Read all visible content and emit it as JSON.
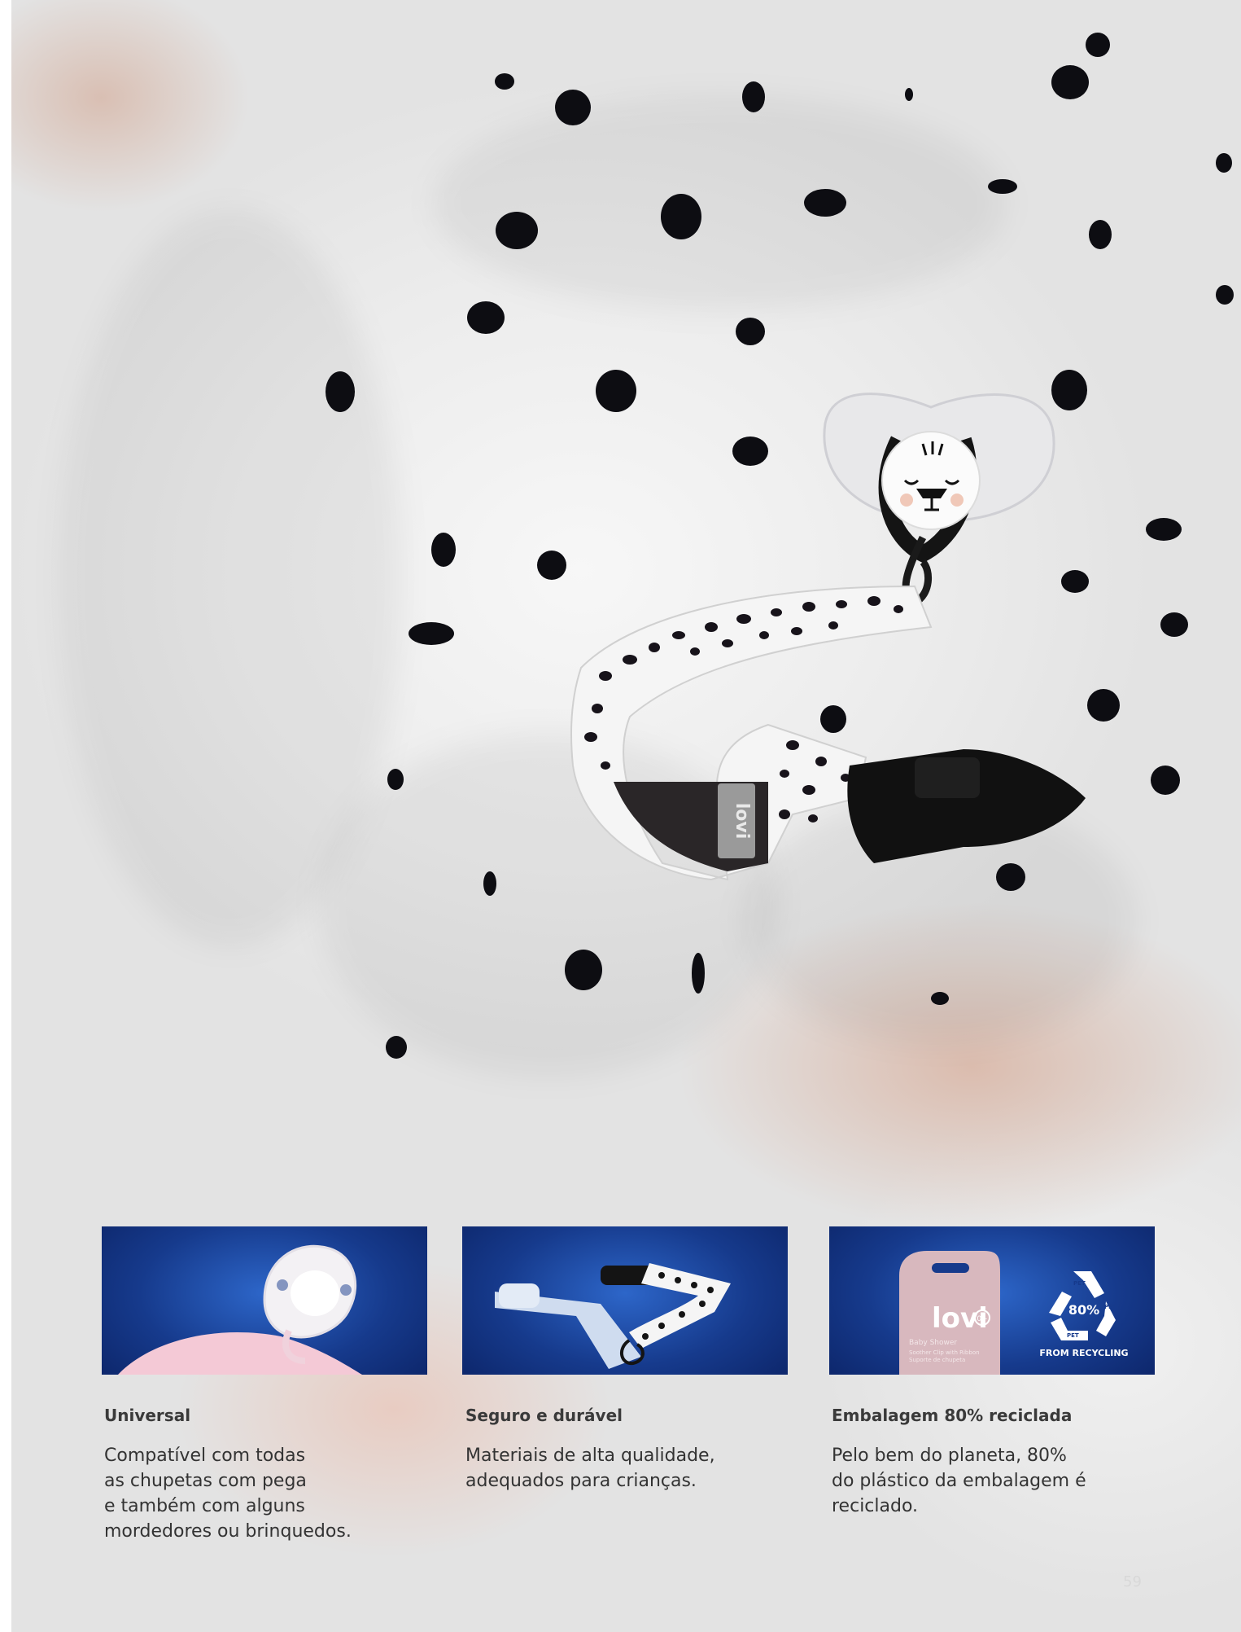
{
  "features": [
    {
      "title": "Universal",
      "description": "Compatível com todas\nas chupetas com pega\ne também com alguns\nmordedores ou brinquedos."
    },
    {
      "title": "Seguro e durável",
      "description": " Materiais de alta qualidade,\nadequados para crianças."
    },
    {
      "title": "Embalagem 80% reciclada",
      "description": "Pelo bem do planeta, 80%\ndo plástico da embalagem é\nreciclado."
    }
  ],
  "brand": {
    "strap_tag": "lovi",
    "package_logo": "lovi",
    "package_age": "0+",
    "package_product": "Baby Shower",
    "package_subtitle_1": "Soother Clip with Ribbon",
    "package_subtitle_2": "Suporte de chupeta"
  },
  "recycling": {
    "percent_label": "80%",
    "material_label": "PET",
    "caption": "FROM RECYCLING"
  },
  "page_number": "59",
  "colors": {
    "card_blue": "#163a8c",
    "title_text": "#3a3a3a",
    "body_text": "#333333"
  }
}
